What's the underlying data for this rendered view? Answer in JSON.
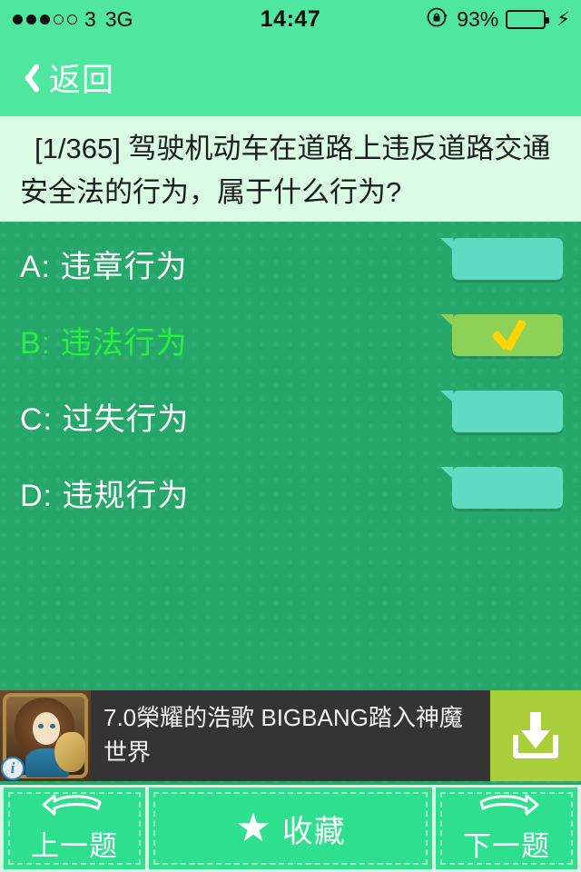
{
  "statusbar": {
    "signal_dots_total": 5,
    "signal_dots_filled": 3,
    "carrier": "3",
    "network": "3G",
    "time": "14:47",
    "rotation_lock_icon": "rotation-lock-icon",
    "battery_percent": "93%",
    "battery_level": 93,
    "charging_icon": "lightning-bolt-icon"
  },
  "navbar": {
    "back_label": "返回",
    "back_icon": "chevron-left-icon",
    "bg_color": "#4fe6a0"
  },
  "question": {
    "index_label": "[1/365]",
    "text": "[1/365] 驾驶机动车在道路上违反道路交通安全法的行为，属于什么行为?",
    "panel_bg": "#dafbe3"
  },
  "options": [
    {
      "label": "A: 违章行为",
      "correct": false,
      "badge_color": "#5fdbc4"
    },
    {
      "label": "B: 违法行为",
      "correct": true,
      "badge_color": "#8ed157",
      "check_color": "#ffd400"
    },
    {
      "label": "C: 过失行为",
      "correct": false,
      "badge_color": "#5fdbc4"
    },
    {
      "label": "D: 违规行为",
      "correct": false,
      "badge_color": "#5fdbc4"
    }
  ],
  "ad": {
    "text": "7.0榮耀的浩歌 BIGBANG踏入神魔世界",
    "info_icon": "info-icon",
    "info_label": "i",
    "download_icon": "download-icon",
    "download_bg": "#a9ce3a",
    "banner_bg": "#343434"
  },
  "toolbar": {
    "prev_label": "上一题",
    "prev_icon": "curved-arrow-left-icon",
    "fav_label": "收藏",
    "fav_icon": "star-icon",
    "fav_glyph": "★",
    "next_label": "下一题",
    "next_icon": "curved-arrow-right-icon",
    "button_bg": "#2ee08d"
  },
  "theme": {
    "page_bg": "#25a76a",
    "accent": "#4fe6a0",
    "correct_text": "#27f13f",
    "option_text": "#ffffff"
  }
}
